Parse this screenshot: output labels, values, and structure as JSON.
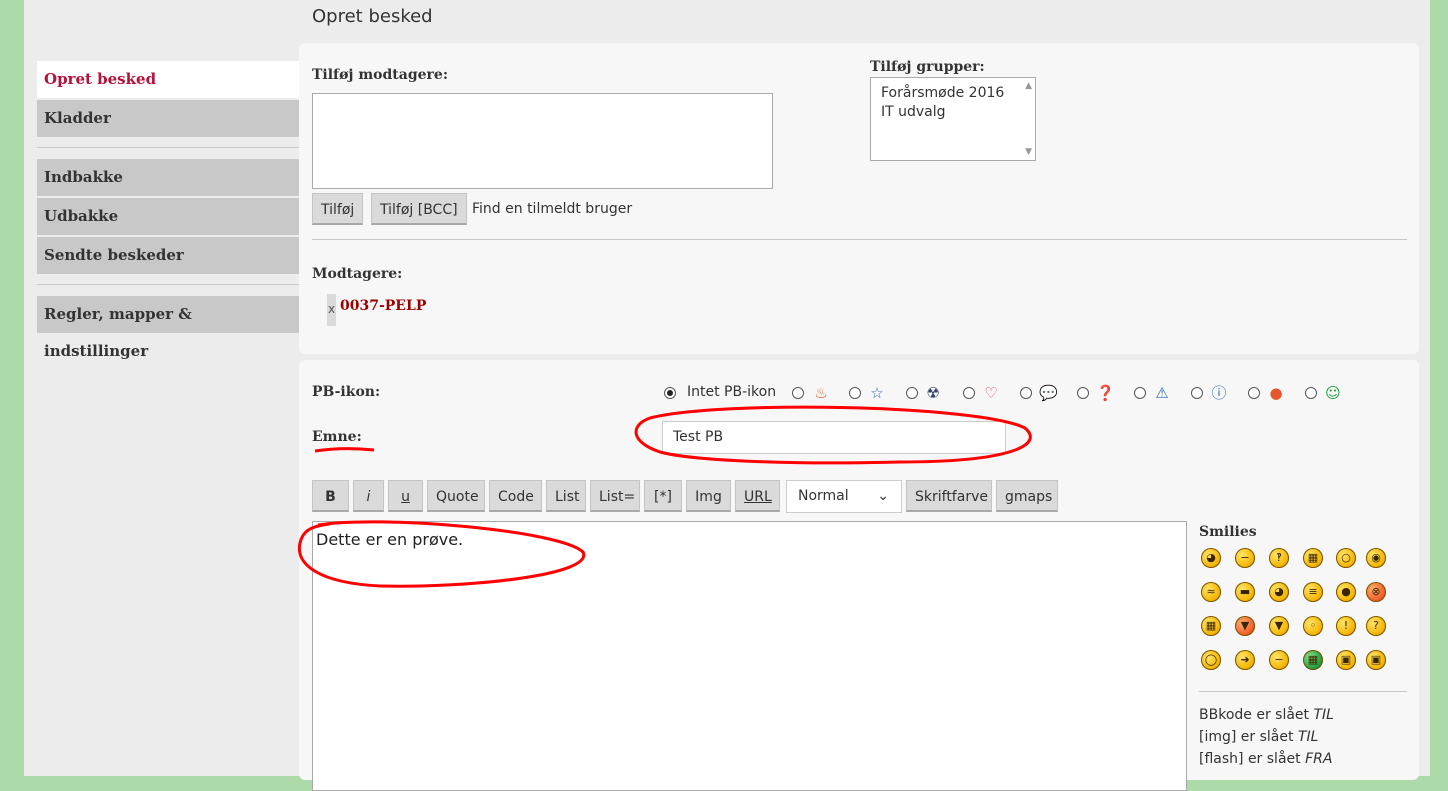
{
  "page_title": "Opret besked",
  "sidebar": {
    "items": [
      {
        "label": "Opret besked",
        "active": true
      },
      {
        "label": "Kladder"
      },
      {
        "label": "Indbakke"
      },
      {
        "label": "Udbakke"
      },
      {
        "label": "Sendte beskeder"
      },
      {
        "label": "Regler, mapper & indstillinger"
      }
    ]
  },
  "recipients_section": {
    "add_recipients_label": "Tilføj modtagere:",
    "add_button": "Tilføj",
    "add_bcc_button": "Tilføj [BCC]",
    "find_user_link": "Find en tilmeldt bruger",
    "add_groups_label": "Tilføj grupper:",
    "groups": [
      "Forårsmøde 2016",
      "IT udvalg"
    ],
    "recipients_label": "Modtagere:",
    "remove_symbol": "x",
    "recipients": [
      "0037-PELP"
    ]
  },
  "pb_icon": {
    "label": "PB-ikon:",
    "none_label": "Intet PB-ikon",
    "selected": "none",
    "icons": [
      "fire-icon",
      "star-icon",
      "radioactive-icon",
      "heart-icon",
      "speech-bubble-icon",
      "question-icon",
      "warning-icon",
      "info-icon",
      "thumbs-down-icon",
      "grin-icon"
    ]
  },
  "subject": {
    "label": "Emne:",
    "value": "Test PB"
  },
  "toolbar": {
    "buttons": [
      "B",
      "i",
      "u",
      "Quote",
      "Code",
      "List",
      "List=",
      "[*]",
      "Img",
      "URL"
    ],
    "font_size": "Normal",
    "font_color": "Skriftfarve",
    "gmaps": "gmaps"
  },
  "message": {
    "value": "Dette er en prøve."
  },
  "smilies": {
    "title": "Smilies",
    "rows": [
      [
        "biggrin",
        "neutral",
        "smile",
        "sad-teeth",
        "surprised",
        "eek"
      ],
      [
        "confused",
        "cool",
        "laugh",
        "mad",
        "razz",
        "angry"
      ],
      [
        "mrgreen",
        "evil",
        "twisted",
        "rolleyes",
        "exclaim",
        "question"
      ],
      [
        "idea",
        "arrow",
        "neutral2",
        "green-teeth",
        "nerd-green",
        "nerd"
      ]
    ]
  },
  "bbcode_status": [
    {
      "text": "BBkode er slået",
      "state": "TIL"
    },
    {
      "text": "[img] er slået",
      "state": "TIL"
    },
    {
      "text": "[flash] er slået",
      "state": "FRA"
    }
  ],
  "colors": {
    "active_nav": "#b5123a",
    "recipient": "#9b0000",
    "annotation": "#ff0000",
    "background": "#acdba9"
  }
}
